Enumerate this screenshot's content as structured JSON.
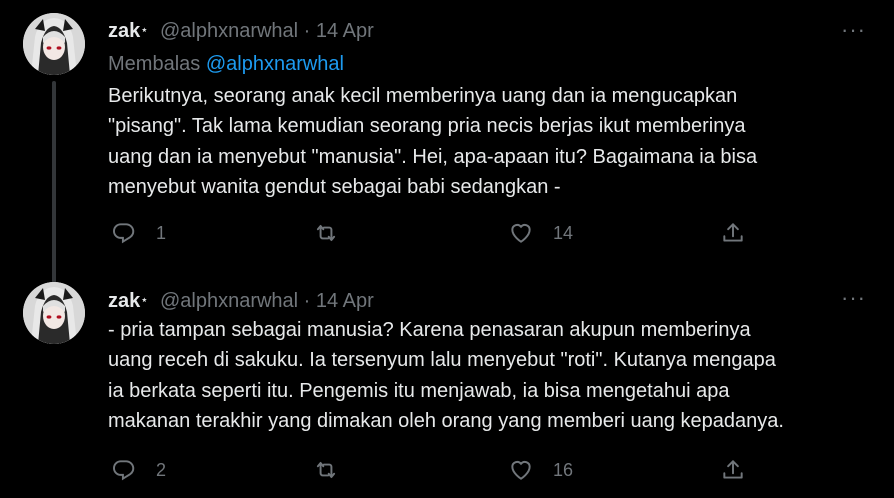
{
  "tweets": [
    {
      "name": "zak",
      "badge": "⋆",
      "handle": "@alphxnarwhal",
      "separator": "·",
      "date": "14 Apr",
      "reply_prefix": "Membalas",
      "reply_handle": "@alphxnarwhal",
      "lines": [
        "Berikutnya, seorang anak kecil memberinya uang dan ia mengucapkan",
        "\"pisang\". Tak lama kemudian seorang pria necis berjas ikut memberinya",
        "uang dan ia menyebut \"manusia\". Hei, apa-apaan itu? Bagaimana ia bisa",
        "menyebut wanita gendut sebagai babi sedangkan -"
      ],
      "reply_count": "1",
      "retweet_count": "",
      "like_count": "14",
      "more_label": "···"
    },
    {
      "name": "zak",
      "badge": "⋆",
      "handle": "@alphxnarwhal",
      "separator": "·",
      "date": "14 Apr",
      "lines": [
        "- pria tampan sebagai manusia? Karena penasaran akupun memberinya",
        "uang receh di sakuku. Ia tersenyum lalu menyebut \"roti\". Kutanya mengapa",
        "ia berkata seperti itu. Pengemis itu menjawab, ia bisa mengetahui apa",
        "makanan terakhir yang dimakan oleh orang yang memberi uang kepadanya."
      ],
      "reply_count": "2",
      "retweet_count": "",
      "like_count": "16",
      "more_label": "···"
    }
  ],
  "icons": {
    "reply": "reply-icon",
    "retweet": "retweet-icon",
    "like": "heart-icon",
    "share": "share-icon",
    "more": "more-icon"
  },
  "colors": {
    "background": "#000000",
    "text": "#e7e9ea",
    "muted": "#71767b",
    "link": "#1d9bf0",
    "thread_line": "#333639"
  }
}
